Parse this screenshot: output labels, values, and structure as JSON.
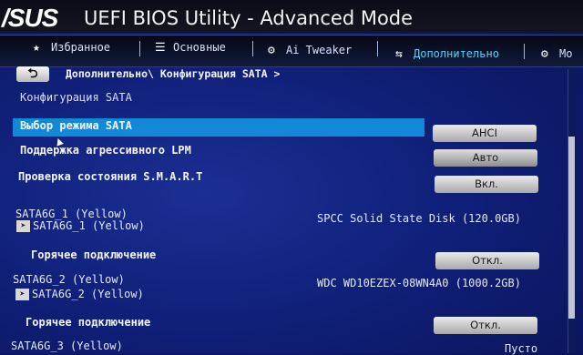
{
  "header": {
    "logo": "/SUS",
    "title": "UEFI BIOS Utility - Advanced Mode"
  },
  "menu": [
    {
      "label": "Избранное",
      "icon": "★"
    },
    {
      "label": "Основные",
      "icon": "☰"
    },
    {
      "label": "Ai Tweaker",
      "icon": "⚙"
    },
    {
      "label": "Дополнительно",
      "icon": "⇆"
    },
    {
      "label": "Мо",
      "icon": "⚙"
    }
  ],
  "breadcrumb": {
    "back_label": "⮌",
    "text": "Дополнительно\\ Конфигурация SATA >"
  },
  "section_title": "Конфигурация SATA",
  "rows": {
    "sata_mode": {
      "label": "Выбор режима SATA",
      "value": "AHCI"
    },
    "lpm": {
      "label": "Поддержка агрессивного LPM",
      "value": "Авто"
    },
    "smart": {
      "label": "Проверка состояния S.M.A.R.T",
      "value": "Вкл."
    }
  },
  "ports": [
    {
      "name": "SATA6G_1 (Yellow)",
      "sub": "SATA6G_1 (Yellow)",
      "device": "SPCC Solid State Disk (120.0GB)",
      "hotplug_label": "Горячее подключение",
      "hotplug_value": "Откл."
    },
    {
      "name": "SATA6G_2 (Yellow)",
      "sub": "SATA6G_2 (Yellow)",
      "device": "WDC WD10EZEX-08WN4A0 (1000.2GB)",
      "hotplug_label": "Горячее подключение",
      "hotplug_value": "Откл."
    },
    {
      "name": "SATA6G_3 (Yellow)",
      "device": "Пусто"
    }
  ]
}
